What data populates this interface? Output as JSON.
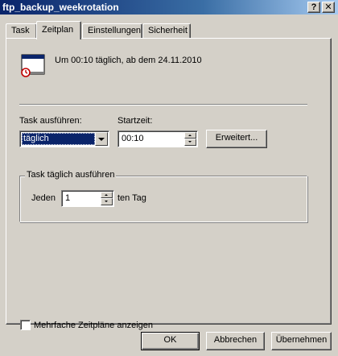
{
  "window": {
    "title": "ftp_backup_weekrotation",
    "help_glyph": "?",
    "close_glyph": "✕"
  },
  "tabs": [
    {
      "label": "Task"
    },
    {
      "label": "Zeitplan"
    },
    {
      "label": "Einstellungen"
    },
    {
      "label": "Sicherheit"
    }
  ],
  "schedule": {
    "icon": "calendar-schedule-icon",
    "summary": "Um 00:10 täglich, ab dem 24.11.2010",
    "run_task_label": "Task ausführen:",
    "run_task_value": "täglich",
    "start_time_label": "Startzeit:",
    "start_time_value": "00:10",
    "advanced_button": "Erweitert..."
  },
  "daily_group": {
    "title": "Task täglich ausführen",
    "every_label": "Jeden",
    "every_value": "1",
    "suffix": "ten Tag"
  },
  "multi_schedule": {
    "label": "Mehrfache Zeitpläne anzeigen",
    "checked": false
  },
  "buttons": {
    "ok": "OK",
    "cancel": "Abbrechen",
    "apply": "Übernehmen"
  },
  "colors": {
    "titlebar": "#0a246a",
    "face": "#d4d0c8",
    "selection": "#0a246a"
  }
}
